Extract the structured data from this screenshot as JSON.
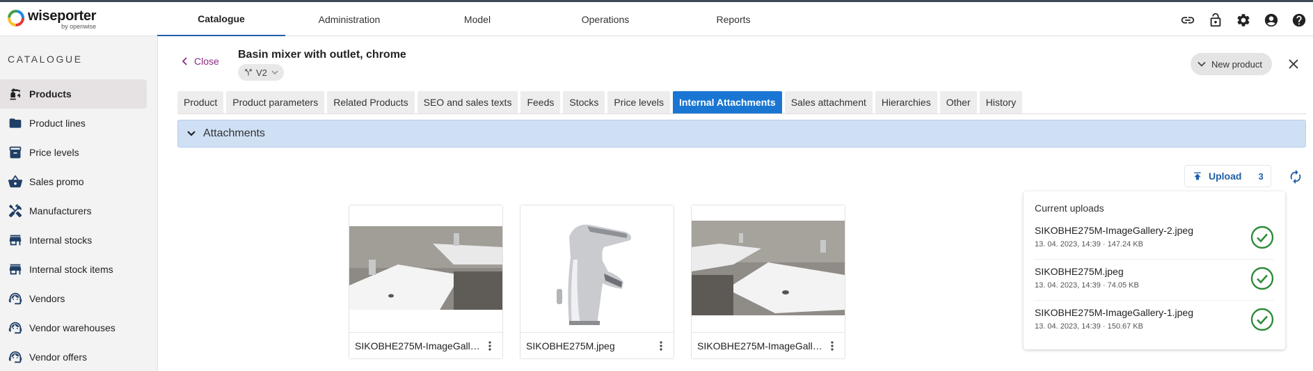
{
  "app": {
    "logo_text": "wiseporter",
    "logo_sub": "by openwise"
  },
  "topnav": [
    {
      "label": "Catalogue",
      "active": true
    },
    {
      "label": "Administration"
    },
    {
      "label": "Model"
    },
    {
      "label": "Operations"
    },
    {
      "label": "Reports"
    }
  ],
  "topicons": [
    "link-icon",
    "lock-icon",
    "gear-icon",
    "account-icon",
    "help-icon"
  ],
  "sidebar": {
    "title": "CATALOGUE",
    "items": [
      {
        "label": "Products",
        "icon": "products-icon",
        "active": true
      },
      {
        "label": "Product lines",
        "icon": "folder-icon"
      },
      {
        "label": "Price levels",
        "icon": "archive-icon"
      },
      {
        "label": "Sales promo",
        "icon": "basket-icon"
      },
      {
        "label": "Manufacturers",
        "icon": "tools-icon"
      },
      {
        "label": "Internal stocks",
        "icon": "store-icon"
      },
      {
        "label": "Internal stock items",
        "icon": "store-icon"
      },
      {
        "label": "Vendors",
        "icon": "support-agent-icon"
      },
      {
        "label": "Vendor warehouses",
        "icon": "support-agent-icon"
      },
      {
        "label": "Vendor offers",
        "icon": "support-agent-icon"
      }
    ]
  },
  "header": {
    "close_label": "Close",
    "product_title": "Basin mixer with outlet, chrome",
    "version": "V2",
    "new_product_label": "New product"
  },
  "tabs": [
    {
      "label": "Product"
    },
    {
      "label": "Product parameters"
    },
    {
      "label": "Related Products"
    },
    {
      "label": "SEO and sales texts"
    },
    {
      "label": "Feeds"
    },
    {
      "label": "Stocks"
    },
    {
      "label": "Price levels"
    },
    {
      "label": "Internal Attachments",
      "active": true
    },
    {
      "label": "Sales attachment"
    },
    {
      "label": "Hierarchies"
    },
    {
      "label": "Other"
    },
    {
      "label": "History"
    }
  ],
  "attachments": {
    "section_label": "Attachments",
    "upload_label": "Upload",
    "upload_count": "3",
    "files": [
      {
        "name": "SIKOBHE275M-ImageGallery-2.jpeg"
      },
      {
        "name": "SIKOBHE275M.jpeg"
      },
      {
        "name": "SIKOBHE275M-ImageGallery-1.jpeg"
      }
    ]
  },
  "uploads": {
    "title": "Current uploads",
    "items": [
      {
        "name": "SIKOBHE275M-ImageGallery-2.jpeg",
        "meta": "13. 04. 2023, 14:39 · 147.24 KB"
      },
      {
        "name": "SIKOBHE275M.jpeg",
        "meta": "13. 04. 2023, 14:39 · 74.05 KB"
      },
      {
        "name": "SIKOBHE275M-ImageGallery-1.jpeg",
        "meta": "13. 04. 2023, 14:39 · 150.67 KB"
      }
    ]
  },
  "colors": {
    "accent": "#1976d2",
    "brand_purple": "#8a2a85",
    "success": "#2e8b3a",
    "section_bg": "#cfe0f5"
  }
}
